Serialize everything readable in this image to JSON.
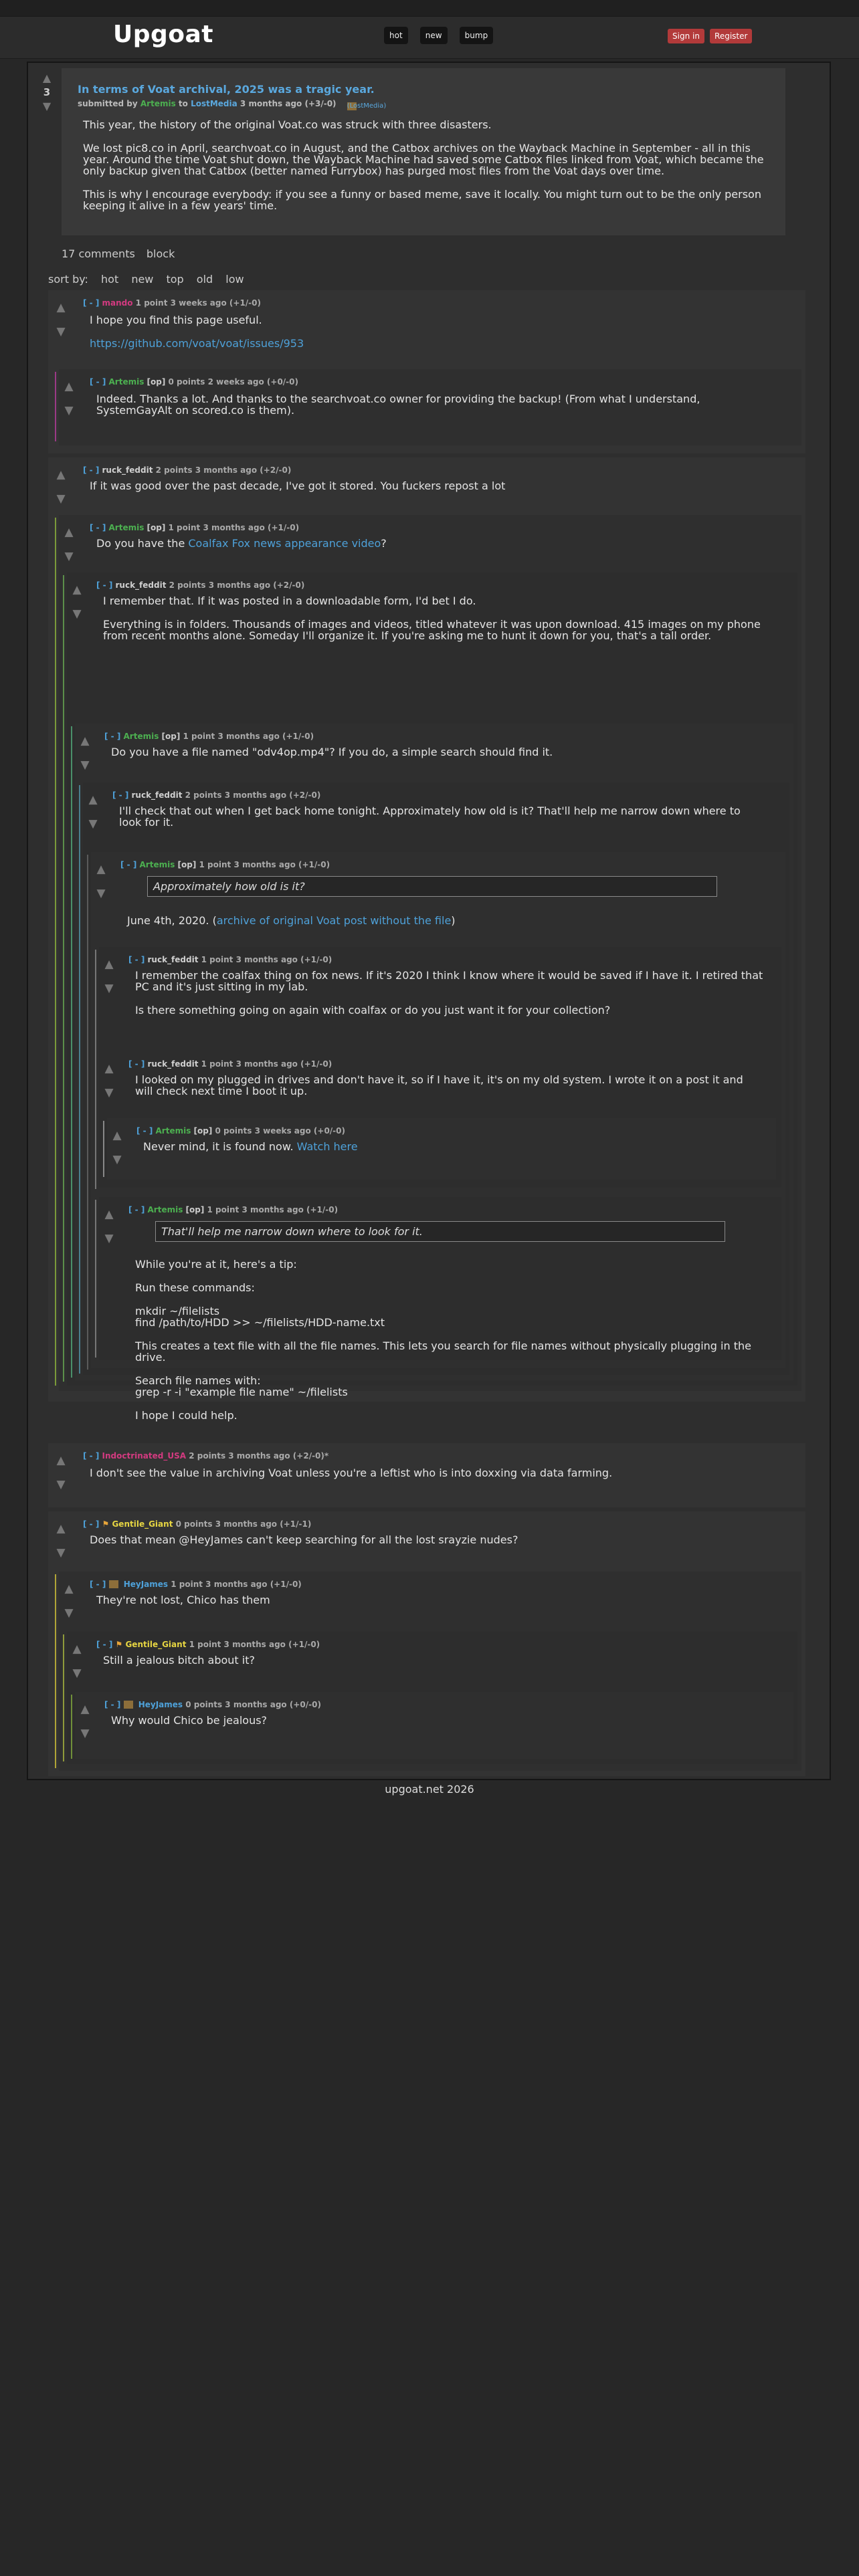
{
  "site": {
    "logo": "Upgoat",
    "tabs": [
      "hot",
      "new",
      "bump"
    ],
    "auth": [
      "Sign in",
      "Register"
    ],
    "footer": "upgoat.net 2026"
  },
  "post": {
    "score": "3",
    "title": "In terms of Voat archival, 2025 was a tragic year.",
    "meta_prefix": "submitted by",
    "author": "Artemis",
    "to": "to",
    "sub": "LostMedia",
    "age": "3 months ago (+3/-0)",
    "flair": "(LostMedia)",
    "paragraphs": [
      "This year, the history of the original Voat.co was struck with three disasters.",
      "We lost pic8.co in April, searchvoat.co in August, and the Catbox archives on the Wayback Machine in September - all in this year. Around the time Voat shut down, the Wayback Machine had saved some Catbox files linked from Voat, which became the only backup given that Catbox (better named Furrybox) has purged most files from the Voat days over time.",
      "This is why I encourage everybody: if you see a funny or based meme, save it locally. You might turn out to be the only person keeping it alive in a few years' time."
    ],
    "comments_link": "17 comments",
    "block_link": "block"
  },
  "sort": {
    "label": "sort by:",
    "options": [
      "hot",
      "new",
      "top",
      "old",
      "low"
    ]
  },
  "comments": {
    "c1": {
      "toggle": "[ - ]",
      "user": "mando",
      "info": "1 point 3 weeks ago (+1/-0)",
      "p1": "I hope you find this page useful.",
      "link": "https://github.com/voat/voat/issues/953"
    },
    "c1a": {
      "toggle": "[ - ]",
      "user": "Artemis",
      "op": "[op]",
      "info": "0 points 2 weeks ago (+0/-0)",
      "text": "Indeed. Thanks a lot. And thanks to the searchvoat.co owner for providing the backup! (From what I understand, SystemGayAlt on scored.co is them)."
    },
    "c2": {
      "toggle": "[ - ]",
      "user": "ruck_feddit",
      "info": "2 points 3 months ago (+2/-0)",
      "text": "If it was good over the past decade, I've got it stored. You fuckers repost a lot"
    },
    "c2a": {
      "toggle": "[ - ]",
      "user": "Artemis",
      "op": "[op]",
      "info": "1 point 3 months ago (+1/-0)",
      "pre": "Do you have the",
      "link": "Coalfax Fox news appearance video",
      "post": "?"
    },
    "c2b": {
      "toggle": "[ - ]",
      "user": "ruck_feddit",
      "info": "2 points 3 months ago (+2/-0)",
      "p1": "I remember that. If it was posted in a downloadable form, I'd bet I do.",
      "p2": "Everything is in folders. Thousands of images and videos, titled whatever it was upon download. 415 images on my phone from recent months alone. Someday I'll organize it. If you're asking me to hunt it down for you, that's a tall order."
    },
    "c2c": {
      "toggle": "[ - ]",
      "user": "Artemis",
      "op": "[op]",
      "info": "1 point 3 months ago (+1/-0)",
      "text": "Do you have a file named \"odv4op.mp4\"? If you do, a simple search should find it."
    },
    "c2d": {
      "toggle": "[ - ]",
      "user": "ruck_feddit",
      "info": "2 points 3 months ago (+2/-0)",
      "text": "I'll check that out when I get back home tonight. Approximately how old is it? That'll help me narrow down where to look for it."
    },
    "c2e": {
      "toggle": "[ - ]",
      "user": "Artemis",
      "op": "[op]",
      "info": "1 point 3 months ago (+1/-0)",
      "quote": "Approximately how old is it?",
      "pre": "June 4th, 2020. (",
      "link": "archive of original Voat post without the file",
      "post": ")"
    },
    "c2f": {
      "toggle": "[ - ]",
      "user": "ruck_feddit",
      "info": "1 point 3 months ago (+1/-0)",
      "p1": "I remember the coalfax thing on fox news. If it's 2020 I think I know where it would be saved if I have it. I retired that PC and it's just sitting in my lab.",
      "p2": "Is there something going on again with coalfax or do you just want it for your collection?"
    },
    "c2g": {
      "toggle": "[ - ]",
      "user": "ruck_feddit",
      "info": "1 point 3 months ago (+1/-0)",
      "text": "I looked on my plugged in drives and don't have it, so if I have it, it's on my old system. I wrote it on a post it and will check next time I boot it up."
    },
    "c2h": {
      "toggle": "[ - ]",
      "user": "Artemis",
      "op": "[op]",
      "info": "0 points 3 weeks ago (+0/-0)",
      "pre": "Never mind, it is found now.",
      "link": "Watch here"
    },
    "c2i": {
      "toggle": "[ - ]",
      "user": "Artemis",
      "op": "[op]",
      "info": "1 point 3 months ago (+1/-0)",
      "quote": "That'll help me narrow down where to look for it.",
      "p1": "While you're at it, here's a tip:",
      "p2": "Run these commands:",
      "cmd1": "mkdir ~/filelists",
      "cmd2": "find /path/to/HDD >> ~/filelists/HDD-name.txt",
      "p3": "This creates a text file with all the file names. This lets you search for file names without physically plugging in the drive.",
      "p4": "Search file names with:",
      "cmd3": "grep -r -i \"example file name\" ~/filelists",
      "p5": "I hope I could help."
    },
    "c3": {
      "toggle": "[ - ]",
      "user": "Indoctrinated_USA",
      "info": "2 points 3 months ago (+2/-0)*",
      "text": "I don't see the value in archiving Voat unless you're a leftist who is into doxxing via data farming."
    },
    "c4": {
      "toggle": "[ - ]",
      "user": "Gentile_Giant",
      "info": "0 points 3 months ago (+1/-1)",
      "text": "Does that mean @HeyJames can't keep searching for all the lost srayzie nudes?"
    },
    "c4a": {
      "toggle": "[ - ]",
      "user": "HeyJames",
      "info": "1 point 3 months ago (+1/-0)",
      "text": "They're not lost, Chico has them"
    },
    "c4b": {
      "toggle": "[ - ]",
      "user": "Gentile_Giant",
      "info": "1 point 3 months ago (+1/-0)",
      "text": "Still a jealous bitch about it?"
    },
    "c4c": {
      "toggle": "[ - ]",
      "user": "HeyJames",
      "info": "0 points 3 months ago (+0/-0)",
      "text": "Why would Chico be jealous?"
    }
  }
}
